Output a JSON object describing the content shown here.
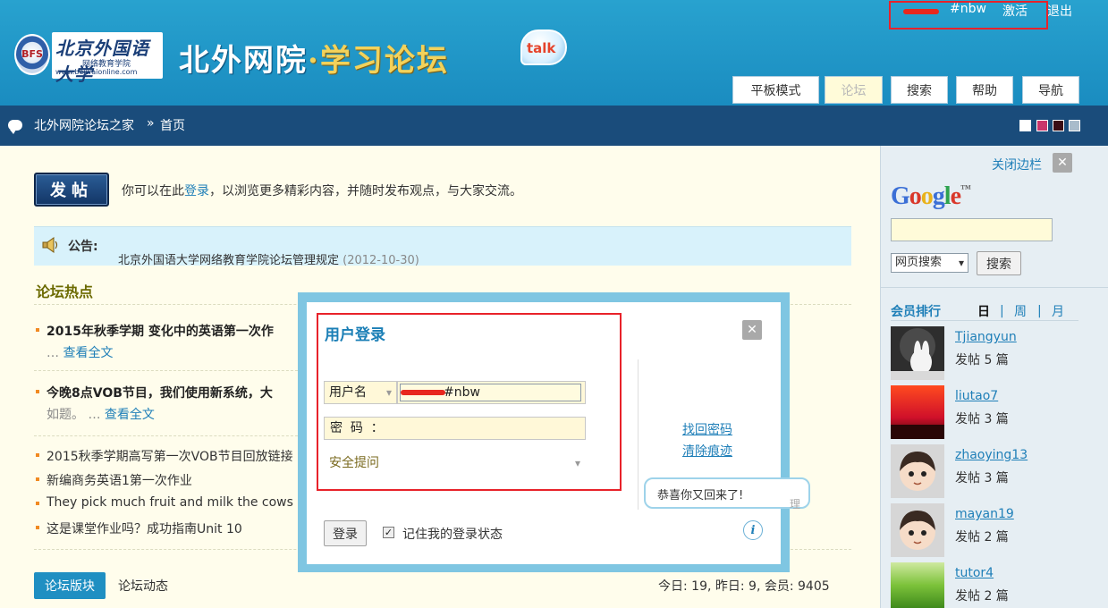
{
  "header": {
    "logo": {
      "school_name": "北京外国语大学",
      "school_subtitle": "网络教育学院",
      "url_text": "www.beiwaionline.com",
      "emblem_text": "BFS"
    },
    "site_title_white": "北外网院",
    "site_title_dot": "·",
    "site_title_yellow": "学习论坛",
    "talk_text": "talk",
    "username": "#nbw",
    "activate_link": "激活",
    "logout_link": "退出",
    "nav": [
      "平板模式",
      "论坛",
      "搜索",
      "帮助",
      "导航"
    ]
  },
  "breadcrumb": {
    "home": "北外网院论坛之家",
    "separator": "»",
    "current": "首页"
  },
  "theme_colors": [
    "#ffffff",
    "#c9356b",
    "#3a0c14",
    "#a9bccb"
  ],
  "main": {
    "post_button": "发帖",
    "intro_before": "你可以在此",
    "intro_link": "登录",
    "intro_after": "，以浏览更多精彩内容，并随时发布观点，与大家交流。",
    "notice_label": "公告:",
    "notice_title": "北京外国语大学网络教育学院论坛管理规定",
    "notice_date": "(2012-10-30)",
    "hot_section_title": "论坛热点",
    "hot_posts": [
      {
        "title": "2015年秋季学期 变化中的英语第一次作",
        "prefix": "… ",
        "more": "查看全文"
      },
      {
        "title": "今晚8点VOB节目，我们使用新系统，大",
        "prefix": "如题。 … ",
        "more": "查看全文"
      }
    ],
    "list_items": [
      "2015秋季学期高写第一次VOB节目回放链接",
      "新编商务英语1第一次作业",
      "They pick much fruit and milk the cows",
      "这是课堂作业吗？成功指南Unit 10"
    ],
    "tab_board": "论坛版块",
    "tab_dynamic": "论坛动态",
    "stats": "今日: 19, 昨日: 9, 会员: 9405"
  },
  "sidebar": {
    "close_label": "关闭边栏",
    "close_x": "✕",
    "google_letters": [
      "G",
      "o",
      "o",
      "g",
      "l",
      "e"
    ],
    "google_tm": "™",
    "search_select": "网页搜索",
    "search_button": "搜索",
    "ranking_title": "会员排行",
    "ranking_tabs": [
      "日",
      "周",
      "月"
    ],
    "ranking_separator": "|",
    "members": [
      {
        "name": "Tjiangyun",
        "posts": "发帖 5 篇"
      },
      {
        "name": "liutao7",
        "posts": "发帖 3 篇"
      },
      {
        "name": "zhaoying13",
        "posts": "发帖 3 篇"
      },
      {
        "name": "mayan19",
        "posts": "发帖 2 篇"
      },
      {
        "name": "tutor4",
        "posts": "发帖 2 篇"
      }
    ]
  },
  "login_dialog": {
    "title": "用户登录",
    "close_x": "✕",
    "username_select": "用户名",
    "username_value": "#nbw",
    "password_label": "密  码  ：",
    "security_question": "安全提问",
    "find_password": "找回密码",
    "clear_traces": "清除痕迹",
    "tooltip": "恭喜你又回来了!",
    "tooltip_ghost": "理",
    "login_button": "登录",
    "remember_me": "记住我的登录状态",
    "remember_checked": true,
    "info_icon_text": "i"
  }
}
